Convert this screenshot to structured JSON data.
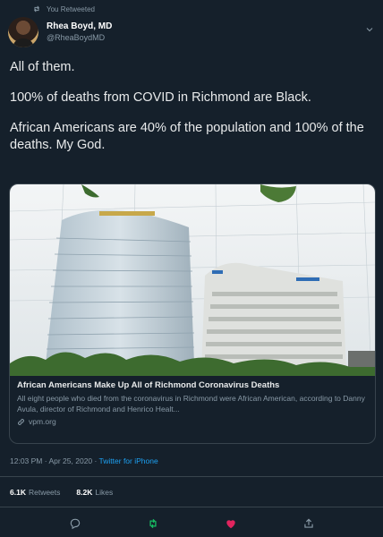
{
  "retweet_banner": {
    "label": "You Retweeted"
  },
  "author": {
    "display_name": "Rhea Boyd, MD",
    "handle": "@RheaBoydMD"
  },
  "tweet": {
    "paragraphs": [
      "All of them.",
      "100% of deaths from COVID in Richmond are Black.",
      "African Americans are 40% of the population and 100% of the deaths. My God."
    ]
  },
  "link_card": {
    "title": "African Americans Make Up All of Richmond Coronavirus Deaths",
    "description": "All eight people who died from the coronavirus in Richmond were African American, according to Danny Avula, director of Richmond and Henrico Healt...",
    "domain": "vpm.org"
  },
  "meta": {
    "timestamp": "12:03 PM · Apr 25, 2020 · ",
    "source": "Twitter for iPhone"
  },
  "stats": {
    "retweets_count": "6.1K",
    "retweets_label": "Retweets",
    "likes_count": "8.2K",
    "likes_label": "Likes"
  },
  "actions": [
    {
      "name": "reply-icon",
      "color": "#8899a6"
    },
    {
      "name": "retweet-icon",
      "color": "#17bf63"
    },
    {
      "name": "like-icon",
      "color": "#e0245e"
    },
    {
      "name": "share-icon",
      "color": "#8899a6"
    }
  ]
}
